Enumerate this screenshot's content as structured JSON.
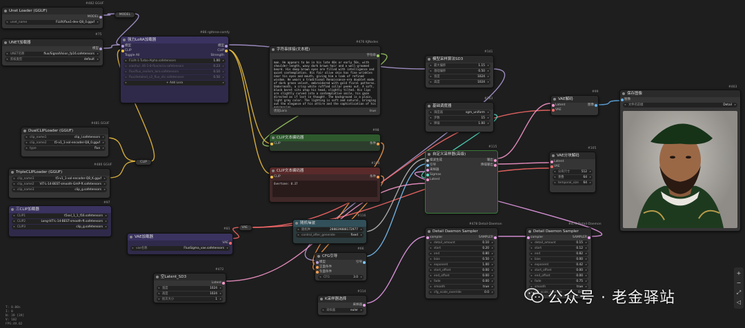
{
  "nodes": {
    "unet_loader_gguf": {
      "title": "Unet Loader (GGUF)",
      "id": "#482 GGUF",
      "output": "MODEL",
      "widgets": [
        {
          "k": "unet_name",
          "v": "FLUX/flux1-dev-Q8_0.gguf"
        }
      ]
    },
    "model_reroute": {
      "label": "MODEL"
    },
    "unet_loader": {
      "title": "UNET加载器",
      "id": "#75",
      "output": "模型",
      "widgets": [
        {
          "k": "UNET名称",
          "v": "flux/SignalVision_fp16.safetensors"
        },
        {
          "k": "剪枝类型",
          "v": "default"
        }
      ]
    },
    "lora_loader": {
      "title": "强力LoRA加载器",
      "id": "#86 rgthree-comfy",
      "inputs": [
        "模型",
        "CLIP"
      ],
      "outputs": [
        "模型",
        "CLIP"
      ],
      "header_row": {
        "k": "Toggle All",
        "v": "Strength"
      },
      "loras": [
        {
          "name": "FLUX-1-Turbo-Alpha.safetensors",
          "v": "1.00",
          "on": true
        },
        {
          "name": "xiaohu/..46-1-8-flux/xiria.safetensors",
          "v": "0.23",
          "on": false
        },
        {
          "name": "flux/flux_realism_lora.safetensors",
          "v": "0.10",
          "on": false
        },
        {
          "name": "flux/detailed_v2_flux_ntc.safetensors",
          "v": "0.50",
          "on": false
        }
      ],
      "add_button": "+ Add Lora"
    },
    "text_node": {
      "title": "字符串拼接(文本框)",
      "id": "#476 KJNodes",
      "output": "字符串",
      "input": "字符串",
      "text": "man. He appears to be in his late 40s or early 50s, with shoulder-length, wavy dark brown hair and a well-groomed beard. His deep brown eyes are filled with intelligence and quiet contemplation. His fair olive skin has fine wrinkles near his eyes and mouth, giving him a look of refined wisdom. He wears a traditional Renaissance-era doublet made of dark green velvet, embroidered with gold floral patterns. Underneath, a crisp white ruffled collar peeks out. A soft, black beret sits atop his head, slightly tilted. His lips are slightly curved into a contemplative smile, his gaze directed as if lost in thought. The background is a plain, light grey color. The lighting is soft and natural, bringing out the elegance of his attire and the sophistication of his expression.",
      "footer_left": "优化Lora",
      "footer_right": "true"
    },
    "model_sampler": {
      "title": "模型采样算法SD3",
      "id": "#141",
      "output": "模型",
      "widgets": [
        {
          "k": "最大偏移",
          "v": "1.15"
        },
        {
          "k": "基础偏移",
          "v": "0.50"
        },
        {
          "k": "宽度",
          "v": "1024"
        },
        {
          "k": "高度",
          "v": "1024"
        }
      ]
    },
    "basic_scheduler": {
      "title": "基础调度器",
      "id": "#143",
      "output": "Sigmas",
      "widgets": [
        {
          "k": "调度器",
          "v": "sgm_uniform"
        },
        {
          "k": "步数",
          "v": "15"
        },
        {
          "k": "降噪",
          "v": "1.00"
        }
      ]
    },
    "vae_decode": {
      "title": "VAE解码",
      "id": "#99",
      "inputs": [
        "Latent",
        "VAE"
      ],
      "output": "图像"
    },
    "save_image": {
      "title": "保存图像",
      "id": "#463",
      "input": "图像",
      "widget": {
        "k": "文件名前缀",
        "v": "Detail"
      }
    },
    "dual_clip": {
      "title": "DualCLIPLoader (GGUF)",
      "id": "#481 GGUF",
      "output": "CLIP",
      "widgets": [
        {
          "k": "clip_name1",
          "v": "clip_l.safetensors"
        },
        {
          "k": "clip_name2",
          "v": "t5-v1_1-xxl-encoder-Q8_0.gguf"
        },
        {
          "k": "type",
          "v": "flux"
        }
      ]
    },
    "clip_reroute": {
      "label": "CLIP"
    },
    "clip_text_pos": {
      "title": "CLIP文本编码器",
      "id": "#98",
      "inputs": [
        "CLIP",
        "文本"
      ],
      "output": "条件"
    },
    "clip_text_neg": {
      "title": "CLIP文本编码器",
      "id": "#100",
      "input": "CLIP",
      "output": "条件",
      "text": "Overtone: 0.37"
    },
    "triple_clip": {
      "title": "TripleCLIPLoader (GGUF)",
      "id": "#480 GGUF",
      "output": "CLIP",
      "widgets": [
        {
          "k": "clip_name1",
          "v": "t5-v1_1-xxl-encoder-Q8_K.gguf"
        },
        {
          "k": "clip_name2",
          "v": "ViT-L-14-BEST-smooth-GmP-ft.safetensors"
        },
        {
          "k": "clip_name3",
          "v": "clip_g.safetensors"
        }
      ]
    },
    "triple_clip_loader": {
      "title": "三CLIP加载器",
      "id": "#97",
      "widgets": [
        {
          "k": "CLIP1",
          "v": "t5xxl_1_1_f16.safetensors"
        },
        {
          "k": "CLIP2",
          "v": "Long-ViT-L-14-BEST-smooth-ft.safetensors"
        },
        {
          "k": "CLIP3",
          "v": "clip_g.safetensors"
        }
      ]
    },
    "custom_sampler": {
      "title": "自定义采样器(高级)",
      "id": "#115",
      "inputs": [
        "噪波生成",
        "引导",
        "采样器",
        "Sigmas",
        "Latent"
      ],
      "outputs": [
        "输出",
        "降噪输出"
      ]
    },
    "vae_tiled_decode": {
      "title": "VAE分块解码",
      "id": "#105",
      "inputs": [
        "Latent",
        "VAE"
      ],
      "output": "图像",
      "widgets": [
        {
          "k": "分块尺寸",
          "v": "512"
        },
        {
          "k": "重叠",
          "v": "64"
        },
        {
          "k": "temporal_size",
          "v": "64"
        },
        {
          "k": "temporal_overlap",
          "v": "8"
        }
      ]
    },
    "vae_reroute": {
      "label": "VAE",
      "id": "#81"
    },
    "vae_loader": {
      "title": "VAE加载器",
      "output": "VAE",
      "widgets": [
        {
          "k": "vae名称",
          "v": "FluxSigma_vae.safetensors"
        }
      ]
    },
    "random_noise": {
      "title": "随机噪波",
      "id": "#116",
      "output": "噪波生成",
      "widgets": [
        {
          "k": "随机种",
          "v": "288839888172977"
        },
        {
          "k": "control_after_generate",
          "v": "fixed"
        }
      ]
    },
    "cfg_guider": {
      "title": "CFG引导",
      "id": "#66",
      "inputs": [
        "模型",
        "正面条件",
        "负面条件"
      ],
      "output": "引导",
      "widgets": [
        {
          "k": "CFG",
          "v": "3.0"
        }
      ]
    },
    "ksampler_select": {
      "title": "K采样器选择",
      "id": "#114",
      "output": "采样器",
      "widgets": [
        {
          "k": "采样器",
          "v": "euler"
        }
      ]
    },
    "detail_daemon_1": {
      "title": "Detail Daemon Sampler",
      "id": "#478 Detail-Daemon",
      "input": "sampler",
      "output": "SAMPLER",
      "widgets": [
        {
          "k": "detail_amount",
          "v": "0.10"
        },
        {
          "k": "start",
          "v": "0.20"
        },
        {
          "k": "end",
          "v": "0.80"
        },
        {
          "k": "bias",
          "v": "0.50"
        },
        {
          "k": "exponent",
          "v": "1.00"
        },
        {
          "k": "start_offset",
          "v": "0.00"
        },
        {
          "k": "end_offset",
          "v": "0.00"
        },
        {
          "k": "fade",
          "v": "0.00"
        },
        {
          "k": "smooth",
          "v": "true"
        },
        {
          "k": "cfg_scale_override",
          "v": "0.0"
        }
      ]
    },
    "detail_daemon_2": {
      "title": "Detail Daemon Sampler",
      "id": "#479 Detail-Daemon",
      "input": "sampler",
      "output": "SAMPLER",
      "widgets": [
        {
          "k": "detail_amount",
          "v": "0.15"
        },
        {
          "k": "start",
          "v": "0.12"
        },
        {
          "k": "end",
          "v": "0.82"
        },
        {
          "k": "bias",
          "v": "0.00"
        },
        {
          "k": "exponent",
          "v": "0.42"
        },
        {
          "k": "start_offset",
          "v": "0.00"
        },
        {
          "k": "end_offset",
          "v": "0.00"
        },
        {
          "k": "fade",
          "v": "0.75"
        },
        {
          "k": "smooth",
          "v": "true"
        },
        {
          "k": "cfg_scale_override",
          "v": "0.0"
        }
      ]
    },
    "empty_latent": {
      "title": "空Latent_SD3",
      "id": "#472",
      "output": "Latent",
      "widgets": [
        {
          "k": "宽度",
          "v": "1024"
        },
        {
          "k": "高度",
          "v": "1024"
        },
        {
          "k": "批次大小",
          "v": "1"
        }
      ]
    }
  },
  "stats": [
    "T: 0.00s",
    "I: 0",
    "N: 39 [39]",
    "V: 102",
    "FPS:49.02"
  ],
  "toolbar_icons": [
    "plus-icon",
    "minus-icon",
    "fit-icon",
    "lock-icon"
  ],
  "toolbar_glyphs": [
    "+",
    "−",
    "⤢",
    "◁"
  ],
  "watermark": "公众号 · 老金驿站",
  "colors": {
    "model": "#b39ddb",
    "clip": "#f5c542",
    "vae": "#ff6b6b",
    "latent": "#ff9ad1",
    "cond": "#ffa04d",
    "sigmas": "#52e0c4",
    "noise": "#c0c0c0",
    "sampler": "#f0a0f0",
    "guider": "#7ec8ff",
    "image": "#64b5f6"
  }
}
